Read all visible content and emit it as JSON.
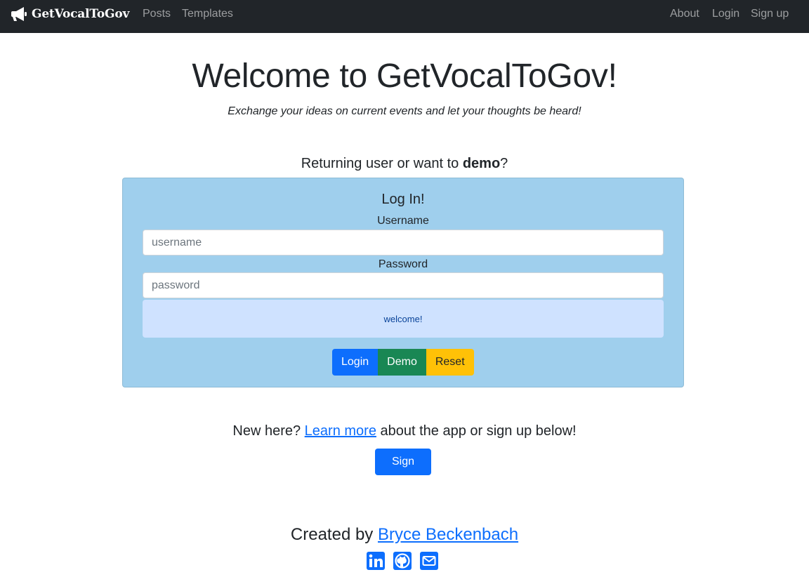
{
  "nav": {
    "brand": "GetVocalToGov",
    "links_left": [
      "Posts",
      "Templates"
    ],
    "links_right": [
      "About",
      "Login",
      "Sign up"
    ]
  },
  "hero": {
    "title": "Welcome to GetVocalToGov!",
    "subtitle": "Exchange your ideas on current events and let your thoughts be heard!"
  },
  "login_section": {
    "prompt_prefix": "Returning user or want to ",
    "prompt_bold": "demo",
    "prompt_suffix": "?",
    "card_title": "Log In!",
    "username_label": "Username",
    "username_placeholder": "username",
    "password_label": "Password",
    "password_placeholder": "password",
    "message": "welcome!",
    "buttons": {
      "login": "Login",
      "demo": "Demo",
      "reset": "Reset"
    }
  },
  "signup_section": {
    "prefix": "New here? ",
    "link": "Learn more",
    "suffix": " about the app or sign up below!",
    "button": "Sign up"
  },
  "footer": {
    "created_prefix": "Created by ",
    "author": "Bryce Beckenbach",
    "social_icons": [
      "linkedin-icon",
      "github-icon",
      "envelope-icon"
    ]
  },
  "colors": {
    "navbar": "#212529",
    "card_background": "#9fcfed",
    "alert_background": "#cfe2ff",
    "primary": "#0d6efd",
    "success": "#198754",
    "warning": "#ffc107"
  }
}
